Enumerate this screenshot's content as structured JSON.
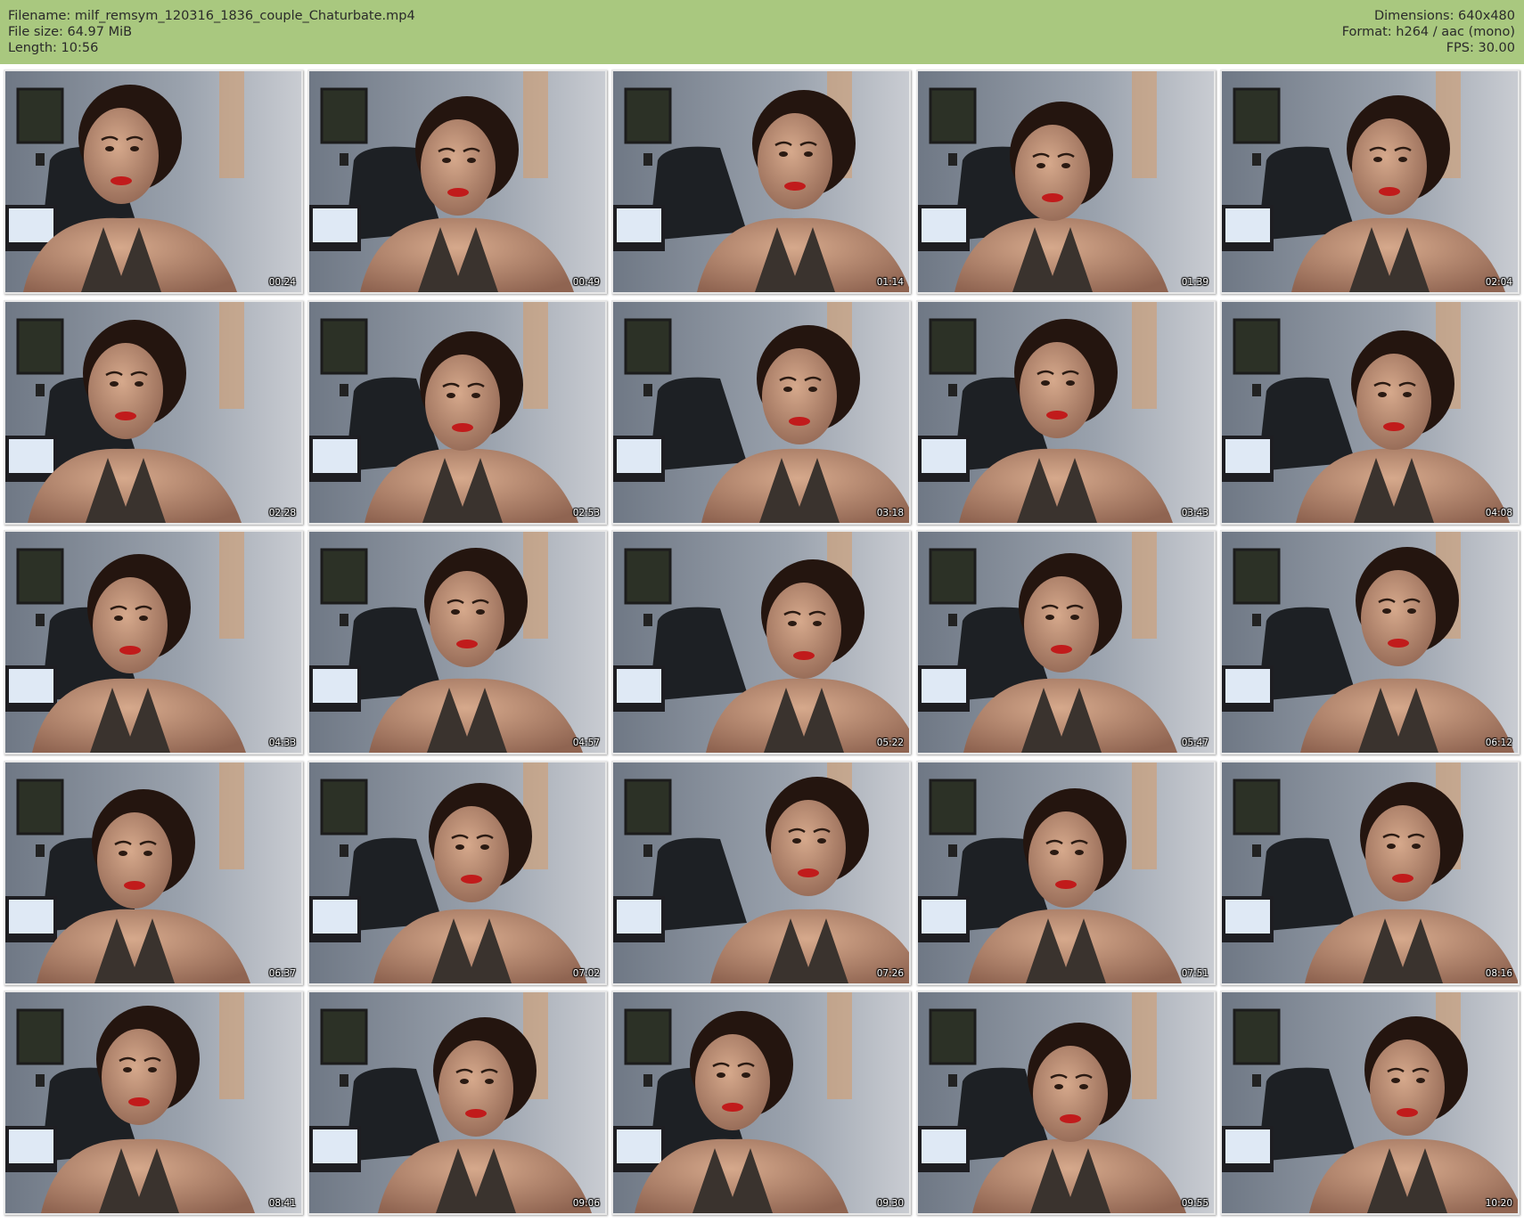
{
  "header": {
    "filename_line": "Filename: milf_remsym_120316_1836_couple_Chaturbate.mp4",
    "filesize_line": "File size: 64.97 MiB",
    "length_line": "Length: 10:56",
    "dimensions_line": "Dimensions: 640x480",
    "format_line": "Format: h264 / aac (mono)",
    "fps_line": "FPS: 30.00",
    "background_color": "#a9c87f"
  },
  "thumbnails": [
    {
      "timestamp": "00:24"
    },
    {
      "timestamp": "00:49"
    },
    {
      "timestamp": "01:14"
    },
    {
      "timestamp": "01:39"
    },
    {
      "timestamp": "02:04"
    },
    {
      "timestamp": "02:28"
    },
    {
      "timestamp": "02:53"
    },
    {
      "timestamp": "03:18"
    },
    {
      "timestamp": "03:43"
    },
    {
      "timestamp": "04:08"
    },
    {
      "timestamp": "04:33"
    },
    {
      "timestamp": "04:57"
    },
    {
      "timestamp": "05:22"
    },
    {
      "timestamp": "05:47"
    },
    {
      "timestamp": "06:12"
    },
    {
      "timestamp": "06:37"
    },
    {
      "timestamp": "07:02"
    },
    {
      "timestamp": "07:26"
    },
    {
      "timestamp": "07:51"
    },
    {
      "timestamp": "08:16"
    },
    {
      "timestamp": "08:41"
    },
    {
      "timestamp": "09:06"
    },
    {
      "timestamp": "09:30"
    },
    {
      "timestamp": "09:55"
    },
    {
      "timestamp": "10:20"
    }
  ]
}
